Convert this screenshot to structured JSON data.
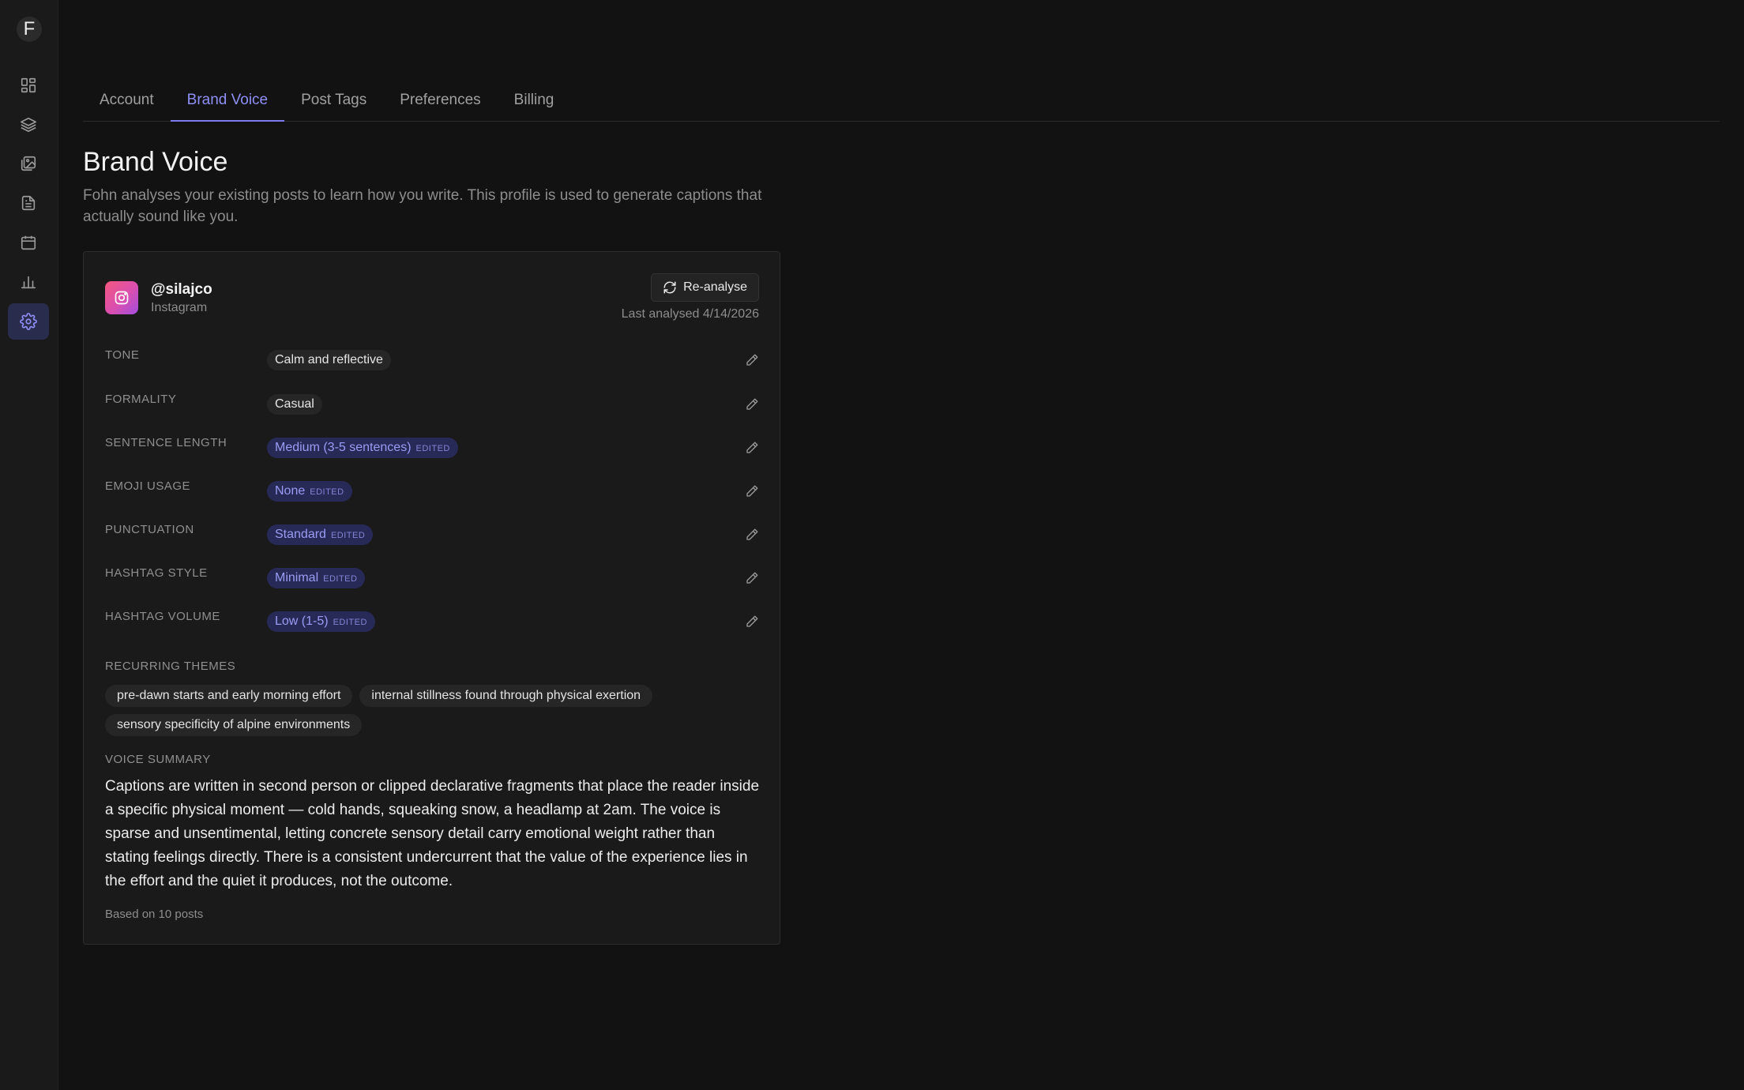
{
  "sidebar": {
    "logo_letter": "F",
    "items": [
      {
        "icon": "dashboard-icon",
        "active": false
      },
      {
        "icon": "layers-icon",
        "active": false
      },
      {
        "icon": "media-library-icon",
        "active": false
      },
      {
        "icon": "document-icon",
        "active": false
      },
      {
        "icon": "calendar-icon",
        "active": false
      },
      {
        "icon": "bar-chart-icon",
        "active": false
      },
      {
        "icon": "gear-icon",
        "active": true
      }
    ]
  },
  "tabs": [
    {
      "label": "Account",
      "active": false
    },
    {
      "label": "Brand Voice",
      "active": true
    },
    {
      "label": "Post Tags",
      "active": false
    },
    {
      "label": "Preferences",
      "active": false
    },
    {
      "label": "Billing",
      "active": false
    }
  ],
  "page": {
    "title": "Brand Voice",
    "description": "Fohn analyses your existing posts to learn how you write. This profile is used to generate captions that actually sound like you."
  },
  "profile": {
    "handle": "@silajco",
    "platform": "Instagram",
    "reanalyse_label": "Re-analyse",
    "last_analysed": "Last analysed 4/14/2026",
    "attributes": [
      {
        "label": "TONE",
        "value": "Calm and reflective",
        "edited": false
      },
      {
        "label": "FORMALITY",
        "value": "Casual",
        "edited": false
      },
      {
        "label": "SENTENCE LENGTH",
        "value": "Medium (3-5 sentences)",
        "edited": true
      },
      {
        "label": "EMOJI USAGE",
        "value": "None",
        "edited": true
      },
      {
        "label": "PUNCTUATION",
        "value": "Standard",
        "edited": true
      },
      {
        "label": "HASHTAG STYLE",
        "value": "Minimal",
        "edited": true
      },
      {
        "label": "HASHTAG VOLUME",
        "value": "Low (1-5)",
        "edited": true
      }
    ],
    "edited_tag": "EDITED",
    "themes_label": "RECURRING THEMES",
    "themes": [
      "pre-dawn starts and early morning effort",
      "internal stillness found through physical exertion",
      "sensory specificity of alpine environments"
    ],
    "summary_label": "VOICE SUMMARY",
    "summary": "Captions are written in second person or clipped declarative fragments that place the reader inside a specific physical moment — cold hands, squeaking snow, a headlamp at 2am. The voice is sparse and unsentimental, letting concrete sensory detail carry emotional weight rather than stating feelings directly. There is a consistent undercurrent that the value of the experience lies in the effort and the quiet it produces, not the outcome.",
    "based_on": "Based on 10 posts"
  },
  "colors": {
    "accent": "#8f8ff5",
    "background": "#121212",
    "card": "#1a1a1a"
  }
}
